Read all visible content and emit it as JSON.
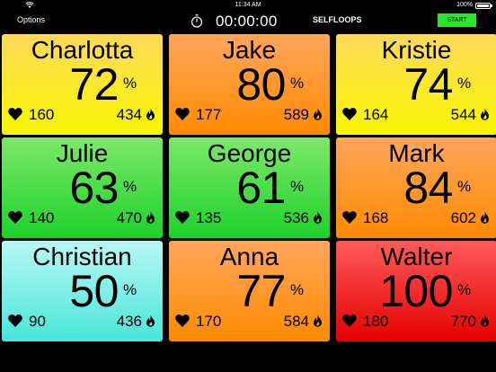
{
  "status_bar": {
    "time": "11:34 AM",
    "battery": "100%"
  },
  "toolbar": {
    "options_label": "Options",
    "timer": "00:00:00",
    "brand": "SELFLOOPS",
    "start_label": "START"
  },
  "percent_unit": "%",
  "tiles": [
    {
      "name": "Charlotta",
      "percent": "72",
      "heart_rate": "160",
      "calories": "434",
      "color_top": "#ffd95a",
      "color_bottom": "#f7f700"
    },
    {
      "name": "Jake",
      "percent": "80",
      "heart_rate": "177",
      "calories": "589",
      "color_top": "#ffa65c",
      "color_bottom": "#ff8a00"
    },
    {
      "name": "Kristie",
      "percent": "74",
      "heart_rate": "164",
      "calories": "544",
      "color_top": "#ffd95a",
      "color_bottom": "#f7f700"
    },
    {
      "name": "Julie",
      "percent": "63",
      "heart_rate": "140",
      "calories": "470",
      "color_top": "#7de86a",
      "color_bottom": "#1dd12a"
    },
    {
      "name": "George",
      "percent": "61",
      "heart_rate": "135",
      "calories": "536",
      "color_top": "#7de86a",
      "color_bottom": "#1dd12a"
    },
    {
      "name": "Mark",
      "percent": "84",
      "heart_rate": "168",
      "calories": "602",
      "color_top": "#ffa65c",
      "color_bottom": "#ff8a00"
    },
    {
      "name": "Christian",
      "percent": "50",
      "heart_rate": "90",
      "calories": "436",
      "color_top": "#b8f7f5",
      "color_bottom": "#47e6d9"
    },
    {
      "name": "Anna",
      "percent": "77",
      "heart_rate": "170",
      "calories": "584",
      "color_top": "#ffa65c",
      "color_bottom": "#ff8a00"
    },
    {
      "name": "Walter",
      "percent": "100",
      "heart_rate": "180",
      "calories": "770",
      "color_top": "#ff5a5a",
      "color_bottom": "#e50000"
    }
  ]
}
